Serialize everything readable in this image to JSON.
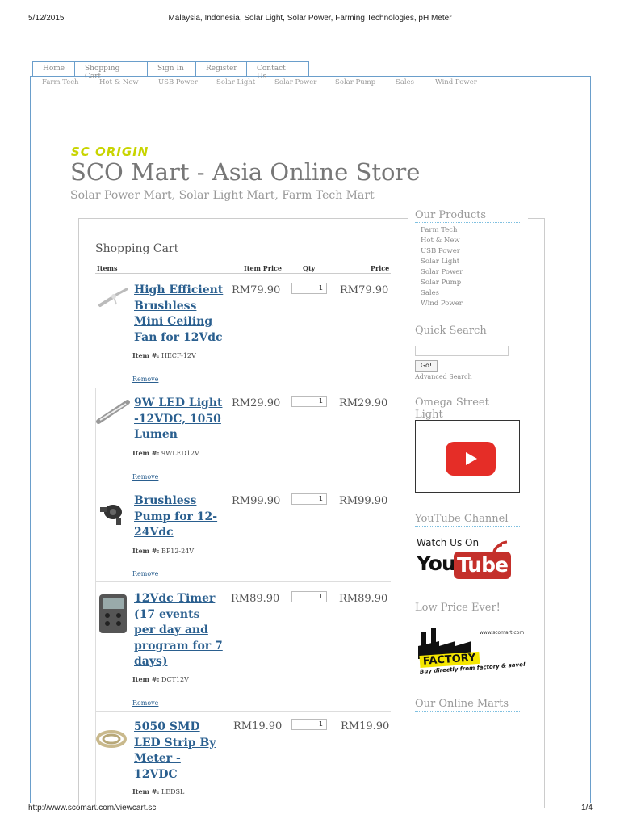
{
  "print_header": {
    "date": "5/12/2015",
    "title": "Malaysia, Indonesia, Solar Light, Solar Power, Farming Technologies, pH Meter"
  },
  "print_footer": {
    "url": "http://www.scomart.com/viewcart.sc",
    "page": "1/4"
  },
  "top_nav": [
    "Home",
    "Shopping Cart",
    "Sign In",
    "Register",
    "Contact Us"
  ],
  "cat_nav": [
    "Farm Tech",
    "Hot & New",
    "USB Power",
    "Solar Light",
    "Solar Power",
    "Solar Pump",
    "Sales",
    "Wind Power"
  ],
  "site": {
    "logo": "SC ORIGIN",
    "title": "SCO Mart - Asia Online Store",
    "subtitle": "Solar Power Mart, Solar Light Mart, Farm Tech Mart"
  },
  "cart": {
    "title": "Shopping Cart",
    "headers": {
      "items": "Items",
      "item_price": "Item Price",
      "qty": "Qty",
      "price": "Price"
    },
    "item_label": "Item #:",
    "remove_label": "Remove",
    "items": [
      {
        "name": "High Efficient Brushless Mini Ceiling Fan for 12Vdc",
        "item_no": "HECF-12V",
        "unit_price": "RM79.90",
        "qty": "1",
        "price": "RM79.90"
      },
      {
        "name": "9W LED Light -12VDC, 1050 Lumen",
        "item_no": "9WLED12V",
        "unit_price": "RM29.90",
        "qty": "1",
        "price": "RM29.90"
      },
      {
        "name": "Brushless Pump for 12-24Vdc",
        "item_no": "BP12-24V",
        "unit_price": "RM99.90",
        "qty": "1",
        "price": "RM99.90"
      },
      {
        "name": "12Vdc Timer (17 events per day and program for 7 days)",
        "item_no": "DCT12V",
        "unit_price": "RM89.90",
        "qty": "1",
        "price": "RM89.90"
      },
      {
        "name": "5050 SMD LED Strip By Meter - 12VDC",
        "item_no": "LEDSL",
        "unit_price": "RM19.90",
        "qty": "1",
        "price": "RM19.90"
      }
    ]
  },
  "sidebar": {
    "products_title": "Our Products",
    "products": [
      "Farm Tech",
      "Hot & New",
      "USB Power",
      "Solar Light",
      "Solar Power",
      "Solar Pump",
      "Sales",
      "Wind Power"
    ],
    "quick_search_title": "Quick Search",
    "go_label": "Go!",
    "advanced_label": "Advanced Search",
    "omega_title": "Omega Street Light",
    "youtube_title": "YouTube Channel",
    "watch_text": "Watch Us On",
    "you_text": "You",
    "tube_text": "Tube",
    "low_price_title": "Low Price Ever!",
    "factory_url": "www.scomart.com",
    "factory_word": "FACTORY",
    "factory_slogan": "Buy directly from factory & save!",
    "online_marts_title": "Our Online Marts"
  },
  "colors": {
    "link": "#2a5f8f",
    "logo": "#c8d400",
    "youtube_red": "#e52d27",
    "nav_border": "#6a9ecb"
  }
}
